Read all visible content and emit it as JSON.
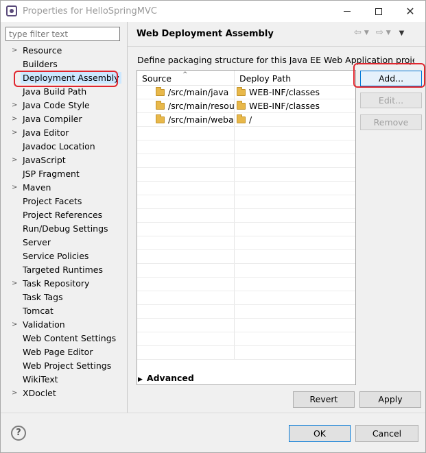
{
  "window": {
    "title": "Properties for HelloSpringMVC"
  },
  "filter": {
    "placeholder": "type filter text"
  },
  "tree": [
    {
      "label": "Resource",
      "expandable": true
    },
    {
      "label": "Builders",
      "expandable": false
    },
    {
      "label": "Deployment Assembly",
      "expandable": false,
      "selected": true
    },
    {
      "label": "Java Build Path",
      "expandable": false
    },
    {
      "label": "Java Code Style",
      "expandable": true
    },
    {
      "label": "Java Compiler",
      "expandable": true
    },
    {
      "label": "Java Editor",
      "expandable": true
    },
    {
      "label": "Javadoc Location",
      "expandable": false
    },
    {
      "label": "JavaScript",
      "expandable": true
    },
    {
      "label": "JSP Fragment",
      "expandable": false
    },
    {
      "label": "Maven",
      "expandable": true
    },
    {
      "label": "Project Facets",
      "expandable": false
    },
    {
      "label": "Project References",
      "expandable": false
    },
    {
      "label": "Run/Debug Settings",
      "expandable": false
    },
    {
      "label": "Server",
      "expandable": false
    },
    {
      "label": "Service Policies",
      "expandable": false
    },
    {
      "label": "Targeted Runtimes",
      "expandable": false
    },
    {
      "label": "Task Repository",
      "expandable": true
    },
    {
      "label": "Task Tags",
      "expandable": false
    },
    {
      "label": "Tomcat",
      "expandable": false
    },
    {
      "label": "Validation",
      "expandable": true
    },
    {
      "label": "Web Content Settings",
      "expandable": false
    },
    {
      "label": "Web Page Editor",
      "expandable": false
    },
    {
      "label": "Web Project Settings",
      "expandable": false
    },
    {
      "label": "WikiText",
      "expandable": false
    },
    {
      "label": "XDoclet",
      "expandable": true
    }
  ],
  "page": {
    "title": "Web Deployment Assembly",
    "description": "Define packaging structure for this Java EE Web Application project.",
    "columns": [
      "Source",
      "Deploy Path"
    ],
    "rows": [
      {
        "source": "/src/main/java",
        "deploy": "WEB-INF/classes"
      },
      {
        "source": "/src/main/resources",
        "deploy": "WEB-INF/classes"
      },
      {
        "source": "/src/main/webapp",
        "deploy": "/"
      }
    ],
    "buttons": {
      "add": "Add...",
      "edit": "Edit...",
      "remove": "Remove"
    },
    "advanced_label": "Advanced",
    "revert_label": "Revert",
    "apply_label": "Apply"
  },
  "footer": {
    "ok_label": "OK",
    "cancel_label": "Cancel",
    "help_symbol": "?"
  },
  "colors": {
    "highlight": "#e0262e",
    "selection": "#cce8ff",
    "focus_border": "#0078d7"
  }
}
